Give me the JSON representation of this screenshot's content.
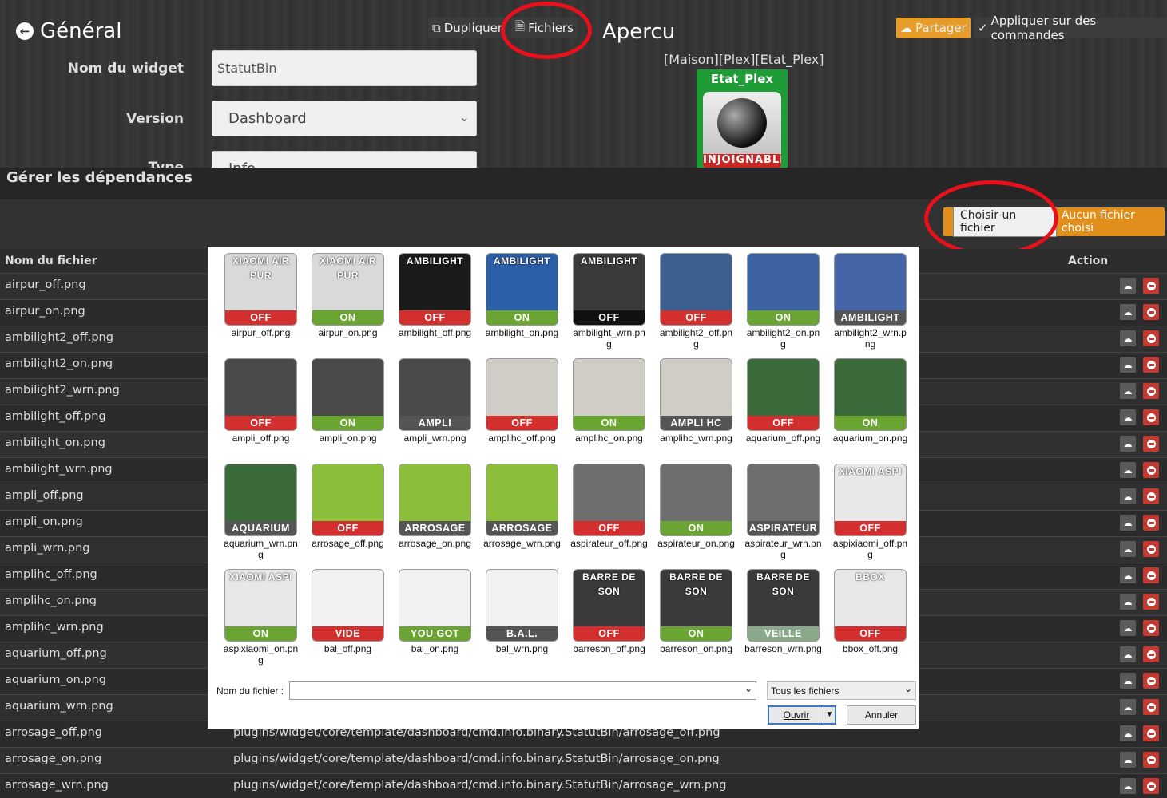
{
  "header": {
    "back_title": "Général",
    "duplicate_label": "Dupliquer",
    "files_label": "Fichiers",
    "preview_title": "Apercu",
    "share_label": "Partager",
    "apply_label": "Appliquer sur des commandes"
  },
  "form": {
    "name_label": "Nom du widget",
    "name_value": "StatutBin",
    "version_label": "Version",
    "version_value": "Dashboard",
    "type_label": "Type",
    "type_value": "Info"
  },
  "preview": {
    "path": "[Maison][Plex][Etat_Plex]",
    "widget_name": "Etat_Plex",
    "widget_state": "INJOIGNABLE"
  },
  "deps": {
    "title": "Gérer les dépendances",
    "choose_btn": "Choisir un fichier",
    "no_file": "Aucun fichier choisi",
    "col_name": "Nom du fichier",
    "col_action": "Action",
    "rows": [
      {
        "name": "airpur_off.png"
      },
      {
        "name": "airpur_on.png"
      },
      {
        "name": "ambilight2_off.png"
      },
      {
        "name": "ambilight2_on.png"
      },
      {
        "name": "ambilight2_wrn.png"
      },
      {
        "name": "ambilight_off.png"
      },
      {
        "name": "ambilight_on.png"
      },
      {
        "name": "ambilight_wrn.png"
      },
      {
        "name": "ampli_off.png"
      },
      {
        "name": "ampli_on.png"
      },
      {
        "name": "ampli_wrn.png"
      },
      {
        "name": "amplihc_off.png"
      },
      {
        "name": "amplihc_on.png"
      },
      {
        "name": "amplihc_wrn.png"
      },
      {
        "name": "aquarium_off.png"
      },
      {
        "name": "aquarium_on.png"
      },
      {
        "name": "aquarium_wrn.png"
      },
      {
        "name": "arrosage_off.png",
        "path": "plugins/widget/core/template/dashboard/cmd.info.binary.StatutBin/arrosage_off.png"
      },
      {
        "name": "arrosage_on.png",
        "path": "plugins/widget/core/template/dashboard/cmd.info.binary.StatutBin/arrosage_on.png"
      },
      {
        "name": "arrosage_wrn.png",
        "path": "plugins/widget/core/template/dashboard/cmd.info.binary.StatutBin/arrosage_wrn.png"
      }
    ]
  },
  "dialog": {
    "filename_label": "Nom du fichier :",
    "filename_value": "",
    "filter": "Tous les fichiers",
    "open_label": "Ouvrir",
    "cancel_label": "Annuler",
    "files": [
      {
        "file": "airpur_off.png",
        "top": "XIAOMI AIR PUR",
        "state": "OFF",
        "bg": "#d9d9d9",
        "bar": "#d32f2f"
      },
      {
        "file": "airpur_on.png",
        "top": "XIAOMI AIR PUR",
        "state": "ON",
        "bg": "#d9d9d9",
        "bar": "#6aa533"
      },
      {
        "file": "ambilight_off.png",
        "top": "AMBILIGHT",
        "state": "OFF",
        "bg": "#1b1b1b",
        "bar": "#d32f2f"
      },
      {
        "file": "ambilight_on.png",
        "top": "AMBILIGHT",
        "state": "ON",
        "bg": "#2b5fa8",
        "bar": "#6aa533"
      },
      {
        "file": "ambilight_wrn.png",
        "top": "AMBILIGHT",
        "state": "OFF",
        "bg": "#3a3a3a",
        "bar": "#111111"
      },
      {
        "file": "ambilight2_off.png",
        "top": "",
        "state": "OFF",
        "bg": "#3c5f8f",
        "bar": "#d32f2f"
      },
      {
        "file": "ambilight2_on.png",
        "top": "",
        "state": "ON",
        "bg": "#3d63a5",
        "bar": "#6aa533"
      },
      {
        "file": "ambilight2_wrn.png",
        "top": "",
        "state": "AMBILIGHT",
        "bg": "#4565a8",
        "bar": "#555555"
      },
      {
        "file": "ampli_off.png",
        "top": "",
        "state": "OFF",
        "bg": "#4a4a4a",
        "bar": "#d32f2f"
      },
      {
        "file": "ampli_on.png",
        "top": "",
        "state": "ON",
        "bg": "#4a4a4a",
        "bar": "#6aa533"
      },
      {
        "file": "ampli_wrn.png",
        "top": "",
        "state": "AMPLI",
        "bg": "#4a4a4a",
        "bar": "#555555"
      },
      {
        "file": "amplihc_off.png",
        "top": "",
        "state": "OFF",
        "bg": "#d0cdc6",
        "bar": "#d32f2f"
      },
      {
        "file": "amplihc_on.png",
        "top": "",
        "state": "ON",
        "bg": "#d0cdc6",
        "bar": "#6aa533"
      },
      {
        "file": "amplihc_wrn.png",
        "top": "",
        "state": "AMPLI HC",
        "bg": "#d0cdc6",
        "bar": "#555555"
      },
      {
        "file": "aquarium_off.png",
        "top": "",
        "state": "OFF",
        "bg": "#3b6b3a",
        "bar": "#d32f2f"
      },
      {
        "file": "aquarium_on.png",
        "top": "",
        "state": "ON",
        "bg": "#3b6b3a",
        "bar": "#6aa533"
      },
      {
        "file": "aquarium_wrn.png",
        "top": "",
        "state": "AQUARIUM",
        "bg": "#3b6b3a",
        "bar": "#555555"
      },
      {
        "file": "arrosage_off.png",
        "top": "",
        "state": "OFF",
        "bg": "#8bbf3a",
        "bar": "#d32f2f"
      },
      {
        "file": "arrosage_on.png",
        "top": "",
        "state": "ARROSAGE",
        "bg": "#8bbf3a",
        "bar": "#555555"
      },
      {
        "file": "arrosage_wrn.png",
        "top": "",
        "state": "ARROSAGE",
        "bg": "#8bbf3a",
        "bar": "#555555"
      },
      {
        "file": "aspirateur_off.png",
        "top": "",
        "state": "OFF",
        "bg": "#6e6e6e",
        "bar": "#d32f2f"
      },
      {
        "file": "aspirateur_on.png",
        "top": "",
        "state": "ON",
        "bg": "#6e6e6e",
        "bar": "#6aa533"
      },
      {
        "file": "aspirateur_wrn.png",
        "top": "",
        "state": "ASPIRATEUR",
        "bg": "#6e6e6e",
        "bar": "#555555"
      },
      {
        "file": "aspixiaomi_off.png",
        "top": "XIAOMI ASPI",
        "state": "OFF",
        "bg": "#e8e8e8",
        "bar": "#d32f2f"
      },
      {
        "file": "aspixiaomi_on.png",
        "top": "XIAOMI ASPI",
        "state": "ON",
        "bg": "#e8e8e8",
        "bar": "#6aa533"
      },
      {
        "file": "bal_off.png",
        "top": "",
        "state": "VIDE",
        "bg": "#f2f2f2",
        "bar": "#d32f2f"
      },
      {
        "file": "bal_on.png",
        "top": "",
        "state": "YOU GOT MAIL",
        "bg": "#f2f2f2",
        "bar": "#6aa533"
      },
      {
        "file": "bal_wrn.png",
        "top": "",
        "state": "B.A.L.",
        "bg": "#f2f2f2",
        "bar": "#555555"
      },
      {
        "file": "barreson_off.png",
        "top": "BARRE DE SON",
        "state": "OFF",
        "bg": "#3a3a3a",
        "bar": "#d32f2f"
      },
      {
        "file": "barreson_on.png",
        "top": "BARRE DE SON",
        "state": "ON",
        "bg": "#3a3a3a",
        "bar": "#6aa533"
      },
      {
        "file": "barreson_wrn.png",
        "top": "BARRE DE SON",
        "state": "VEILLE",
        "bg": "#3a3a3a",
        "bar": "#8aa88a"
      },
      {
        "file": "bbox_off.png",
        "top": "BBOX",
        "state": "OFF",
        "bg": "#e8e8e8",
        "bar": "#d32f2f"
      }
    ]
  },
  "colors": {
    "accent": "#e08f1c",
    "danger": "#c23a31",
    "annotation": "#e8101a"
  }
}
